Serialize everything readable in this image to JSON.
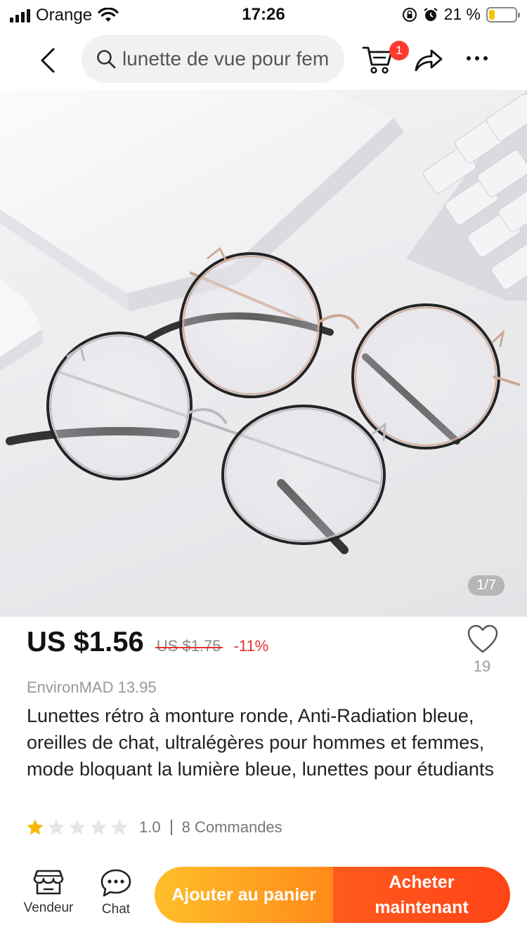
{
  "status_bar": {
    "carrier": "Orange",
    "time": "17:26",
    "battery_percent": "21 %",
    "battery_level": 0.21
  },
  "nav": {
    "search_text": "lunette de vue pour fem",
    "cart_badge": "1"
  },
  "product": {
    "image_counter": "1/7",
    "price_current": "US $1.56",
    "price_original": "US $1.75",
    "discount": "-11%",
    "wishlist_count": "19",
    "store": "EnvironMAD 13.95",
    "title": "Lunettes rétro à monture ronde, Anti-Radiation bleue, oreilles de chat, ultralégères pour hommes et femmes, mode bloquant la lumière bleue, lunettes pour étudiants",
    "rating_value": "1.0",
    "rating_stars": 1,
    "rating_max": 5,
    "orders": "8 Commandes"
  },
  "bottom_bar": {
    "vendor_label": "Vendeur",
    "chat_label": "Chat",
    "add_to_cart": "Ajouter au panier",
    "buy_now": "Acheter maintenant"
  },
  "colors": {
    "accent_red": "#e8312f",
    "add_to_cart_orange": "#ff9a1f",
    "buy_now_red": "#ff4d18",
    "star_filled": "#f5b800",
    "star_empty": "#e6e6e6"
  },
  "icons": {
    "back": "chevron-left-icon",
    "search": "search-icon",
    "cart": "cart-icon",
    "share": "share-icon",
    "more": "more-dots-icon",
    "wishlist": "heart-icon",
    "vendor": "store-icon",
    "chat": "chat-bubble-icon"
  }
}
